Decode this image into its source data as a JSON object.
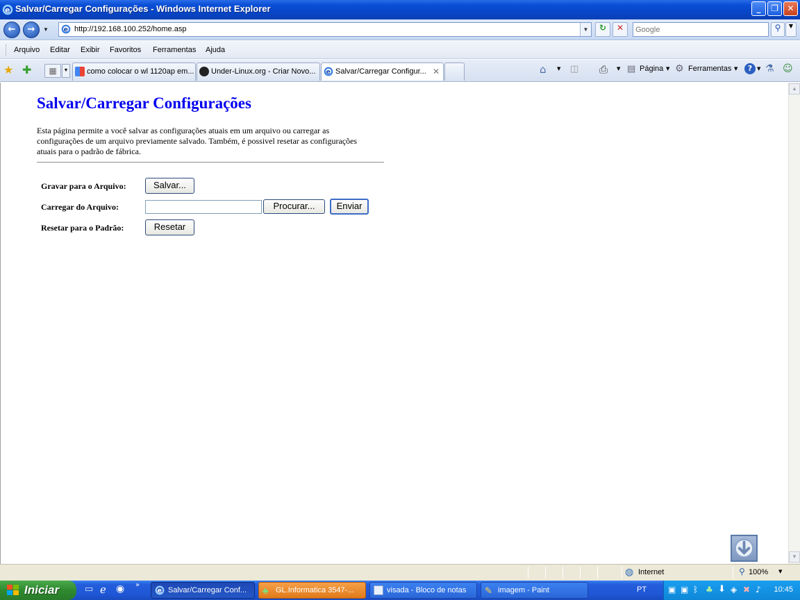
{
  "window": {
    "title": "Salvar/Carregar Configurações - Windows Internet Explorer"
  },
  "addressbar": {
    "url": "http://192.168.100.252/home.asp",
    "search_placeholder": "Google"
  },
  "menu": {
    "items": [
      "Arquivo",
      "Editar",
      "Exibir",
      "Favoritos",
      "Ferramentas",
      "Ajuda"
    ]
  },
  "tabs": [
    {
      "label": "como colocar o wl 1120ap em..."
    },
    {
      "label": "Under-Linux.org - Criar Novo..."
    },
    {
      "label": "Salvar/Carregar Configur..."
    }
  ],
  "commandbar": {
    "page_label": "Página",
    "tools_label": "Ferramentas"
  },
  "page": {
    "title": "Salvar/Carregar Configurações",
    "description": "Esta página permite a você salvar as configurações atuais em um arquivo ou carregar as configurações de um arquivo previamente salvado. Também, é possivel resetar as configurações atuais para o padrão de fábrica.",
    "rows": {
      "save_label": "Gravar para o Arquivo:",
      "save_button": "Salvar...",
      "load_label": "Carregar do Arquivo:",
      "browse_button": "Procurar...",
      "send_button": "Enviar",
      "reset_label": "Resetar para o Padrão:",
      "reset_button": "Resetar"
    }
  },
  "statusbar": {
    "zone": "Internet",
    "zoom": "100%"
  },
  "taskbar": {
    "start_label": "Iniciar",
    "tasks": [
      {
        "label": "Salvar/Carregar Conf..."
      },
      {
        "label": "GL.Informatica 3547-..."
      },
      {
        "label": "visada - Bloco de notas"
      },
      {
        "label": "imagem - Paint"
      }
    ],
    "language": "PT",
    "clock": "10:45"
  },
  "colors": {
    "title_link": "#0000ee",
    "xp_blue": "#245edb",
    "start_green": "#2f8a2f"
  }
}
